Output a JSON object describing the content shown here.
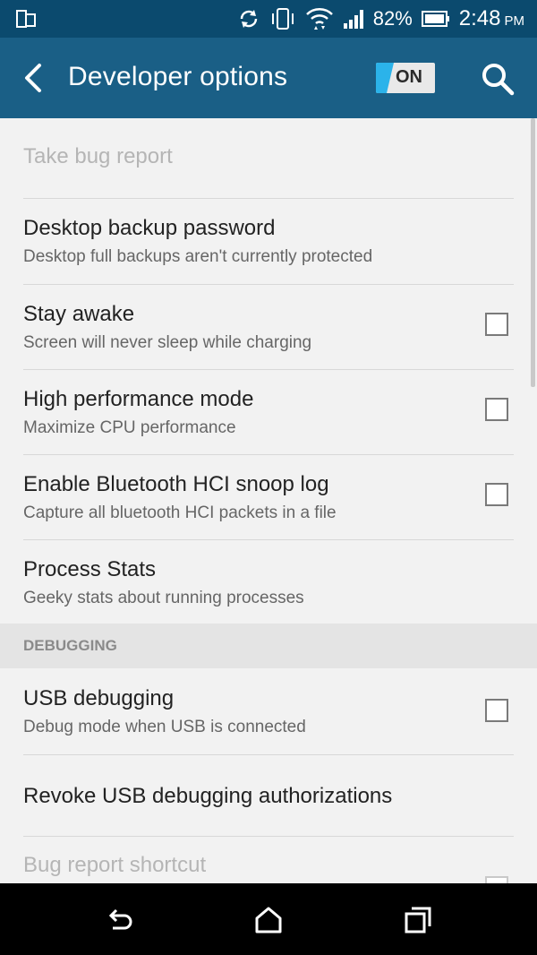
{
  "status_bar": {
    "battery_percent": "82%",
    "time": "2:48",
    "ampm": "PM"
  },
  "header": {
    "title": "Developer options",
    "toggle_label": "ON",
    "accent": "#1a5f86",
    "status_bg": "#0b4a6e"
  },
  "items": [
    {
      "title": "Take bug report",
      "subtitle": ""
    },
    {
      "title": "Desktop backup password",
      "subtitle": "Desktop full backups aren't currently protected"
    },
    {
      "title": "Stay awake",
      "subtitle": "Screen will never sleep while charging"
    },
    {
      "title": "High performance mode",
      "subtitle": "Maximize CPU performance"
    },
    {
      "title": "Enable Bluetooth HCI snoop log",
      "subtitle": "Capture all bluetooth HCI packets in a file"
    },
    {
      "title": "Process Stats",
      "subtitle": "Geeky stats about running processes"
    }
  ],
  "section": {
    "label": "DEBUGGING"
  },
  "debug_items": [
    {
      "title": "USB debugging",
      "subtitle": "Debug mode when USB is connected"
    },
    {
      "title": "Revoke USB debugging authorizations",
      "subtitle": ""
    },
    {
      "title": "Bug report shortcut",
      "subtitle": ""
    }
  ],
  "icons": {
    "status_left": "screen-mirror-icon",
    "sync": "sync-icon",
    "vibrate": "vibrate-icon",
    "wifi": "wifi-icon",
    "signal": "signal-icon",
    "battery": "battery-icon",
    "back": "back-arrow-icon",
    "search": "search-icon",
    "nav_back": "nav-back-icon",
    "nav_home": "nav-home-icon",
    "nav_recents": "nav-recents-icon"
  }
}
